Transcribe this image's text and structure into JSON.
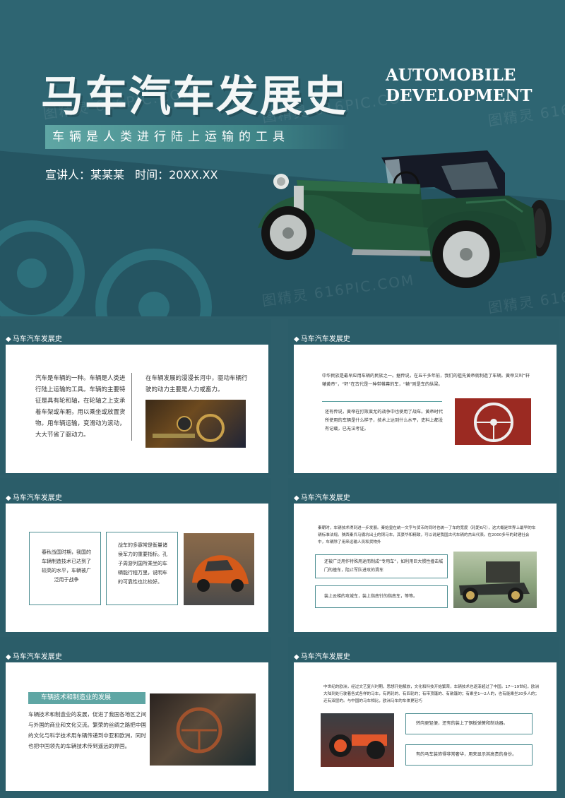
{
  "hero": {
    "title": "马车汽车发展史",
    "title_en_1": "AUTOMOBILE",
    "title_en_2": "DEVELOPMENT",
    "subtitle": "车辆是人类进行陆上运输的工具",
    "speaker_label": "宣讲人：某某某",
    "time_label": "时间：20XX.XX",
    "watermark": "图精灵 616PIC.COM"
  },
  "slides": {
    "s1": {
      "label": "马车汽车发展史",
      "left_text": "汽车是车辆的一种。车辆是人类进行陆上运输的工具。车辆的主要特征是具有轮和轴，在轮轴之上支承着车架或车厢，用以乘坐或放置货物。用车辆运输，变滑动为滚动，大大节省了驱动力。",
      "right_text": "在车辆发展的漫漫长河中，驱动车辆行驶的动力主要是人力或畜力。"
    },
    "s2": {
      "label": "马车汽车发展史",
      "top_text": "中华民族是最早应用车辆的民族之一。据传说，在五千多年前，我们的祖先黄帝就制造了车辆。黄帝又叫“轩辕黄帝”，“轩”在古代是一种带帷幕的车，“辕”则是车的纵梁。",
      "bottom_text": "还有传说，黄帝在打败蚩尤的战争中也使用了战车。黄帝时代所使用的车辆是什么样子，技术上达到什么水平，史料上都没有记载，已无法考证。"
    },
    "s3": {
      "label": "马车汽车发展史",
      "box1_text": "春秋战国时期，我国的车辆制造技术已达到了较高的水平，车辆被广泛用于战争",
      "box2_text": "战车的多寡常是衡量诸侯军力的重要指标。孔子周游列国所乘坐的车辆能行程万里，说明车的可靠性也比较好。"
    },
    "s4": {
      "label": "马车汽车发展史",
      "top_text": "秦朝时，车辆技术得到进一步发展。秦始皇在统一文字与货币的同时也统一了车的宽度（轮距6尺），这大概是世界上最早的车辆标准法规。陕西秦兵马俑坑出土的铜马车，其豪华和精致，可以说是我国古代车辆的杰出代表。在2000多年的封建社会中，车辆除了用来运输人员和货物外",
      "box1_text": "还被广泛用作特殊用途而制成“专用车”，如利用巨大惯性撞击城门的撞车，阻止军队进攻的滑车",
      "box2_text": "装上云梯的攻城车，装上指南针的指南车，等等。"
    },
    "s5": {
      "label": "马车汽车发展史",
      "heading": "车辆技术和制造业的发展",
      "body_text": "车辆技术和制造业的发展，促进了我国各地区之间与外国的商业和文化交流。繁荣的丝绸之路把中国的文化与科学技术用车辆传递到中亚和欧洲，同时也把中国领先的车辆技术传到遥远的异国。"
    },
    "s6": {
      "label": "马车汽车发展史",
      "top_text": "中世纪的欧洲，经过文艺复兴时期，思想开始解放，文化和科技开始繁荣，车辆技术也逐渐超过了中国。17～19世纪，欧洲大陆到处行驶着各式各样的马车，有两轮的、有四轮的；有带顶篷的、有敞篷的；有乘坐1～2人的，也有能乘坐20多人的；还有双层的。与中国的马车相比，欧洲马车的车体更轻巧",
      "box1_text": "转向更轻便，还有的装上了钢板弹簧和制动器。",
      "box2_text": "有的马车装饰得非常奢华，用来显示其高贵的身份。"
    }
  },
  "colors": {
    "background": "#2d5e6a",
    "hero": "#2e6572",
    "accent": "#5fa6a4",
    "car_body": "#1f4e34"
  },
  "icons": [
    "wheel-icon",
    "car-illustration",
    "diamond-bullet-icon"
  ]
}
